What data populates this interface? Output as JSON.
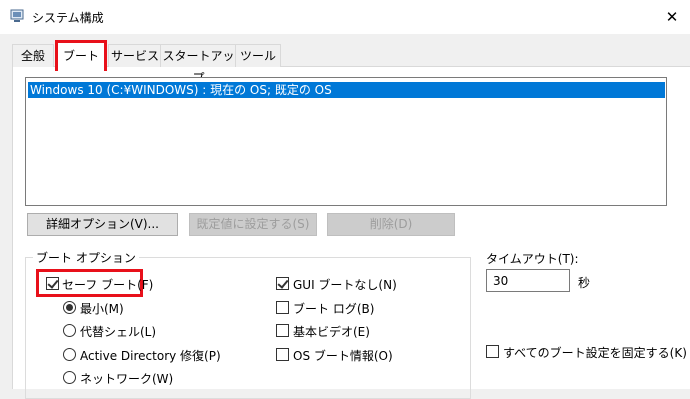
{
  "window": {
    "title": "システム構成",
    "close_glyph": "✕"
  },
  "tabs": [
    "全般",
    "ブート",
    "サービス",
    "スタートアップ",
    "ツール"
  ],
  "os_list": [
    "Windows 10 (C:¥WINDOWS) : 現在の OS; 既定の OS"
  ],
  "buttons": {
    "advanced": "詳細オプション(V)...",
    "set_default": "既定値に設定する(S)",
    "delete": "削除(D)"
  },
  "boot_options": {
    "legend": "ブート オプション",
    "safe_boot": "セーフ ブート(F)",
    "minimal": "最小(M)",
    "alternate_shell": "代替シェル(L)",
    "active_directory": "Active Directory 修復(P)",
    "network": "ネットワーク(W)",
    "no_gui_boot": "GUI ブートなし(N)",
    "boot_log": "ブート ログ(B)",
    "base_video": "基本ビデオ(E)",
    "os_boot_info": "OS ブート情報(O)"
  },
  "timeout": {
    "label": "タイムアウト(T):",
    "value": "30",
    "unit": "秒"
  },
  "make_permanent": "すべてのブート設定を固定する(K)",
  "icons": {
    "window": "system-config-icon"
  },
  "colors": {
    "selection": "#0078d7",
    "highlight_box": "#e8101a"
  }
}
